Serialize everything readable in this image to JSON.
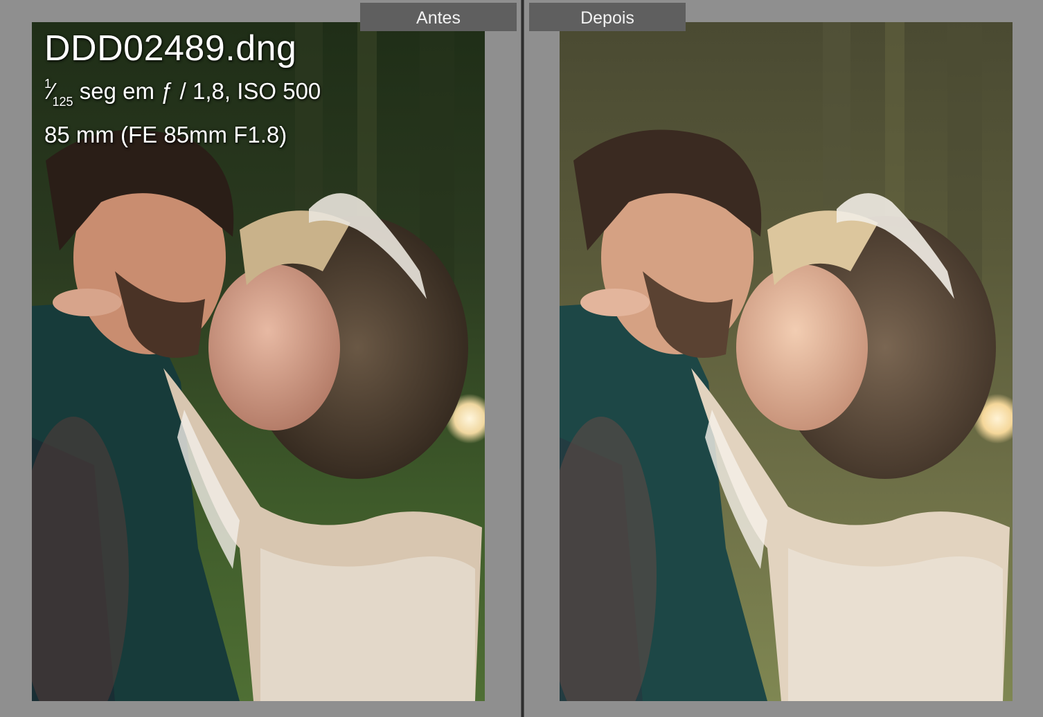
{
  "compare_view": {
    "before_label": "Antes",
    "after_label": "Depois"
  },
  "info_overlay": {
    "filename": "DDD02489.dng",
    "shutter_numerator": "1",
    "shutter_denominator": "125",
    "exposure_rest": " seg em ƒ / 1,8, ISO 500",
    "lens": "85 mm (FE 85mm F1.8)"
  },
  "photos": {
    "before_description_icon": "photo-before-icon",
    "after_description_icon": "photo-after-icon"
  },
  "colors": {
    "app_background": "#8f8f8f",
    "label_background": "#5f5f5f",
    "divider": "#2e2e2e"
  }
}
